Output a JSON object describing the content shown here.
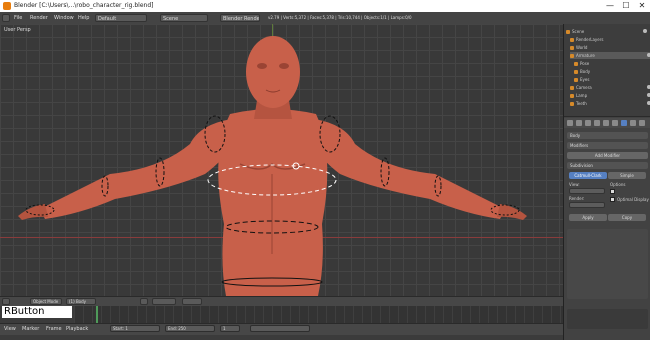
{
  "window": {
    "title": "Blender [C:\\Users\\...\\robo_character_rig.blend]",
    "minimize": "—",
    "maximize": "☐",
    "close": "✕"
  },
  "menubar": {
    "items": [
      "File",
      "Render",
      "Window",
      "Help"
    ],
    "layout": "Default",
    "scene": "Scene",
    "engine": "Blender Render",
    "stats": "v2.79 | Verts:5,372 | Faces:5,378 | Tris:10,744 | Objects:1/1 | Lamps:0/0"
  },
  "viewport": {
    "label": "User Persp",
    "mode": "Object Mode",
    "object_name": "(1) Body",
    "colors": {
      "skin": "#c8604a",
      "skin_shadow": "#9a4434",
      "grid_bg": "#393939"
    }
  },
  "overlay": {
    "key_text": "RButton"
  },
  "outliner": {
    "rows": [
      "Scene",
      "RenderLayers",
      "World",
      "Armature",
      "Pose",
      "Body",
      "Eyes",
      "Camera",
      "Lamp",
      "Teeth"
    ]
  },
  "properties": {
    "object_name": "Body",
    "modifiers_label": "Modifiers",
    "add_modifier": "Add Modifier",
    "subsurf": "Subdivision",
    "catmull": "Catmull-Clark",
    "simple": "Simple",
    "view_label": "View:",
    "render_label": "Render:",
    "options": "Options",
    "optimal_display": "Optimal Display",
    "apply": "Apply",
    "copy": "Copy"
  },
  "timeline": {
    "view": "View",
    "marker": "Marker",
    "frame": "Frame",
    "playback": "Playback",
    "start": "Start: 1",
    "end": "End: 250",
    "current": "1"
  }
}
